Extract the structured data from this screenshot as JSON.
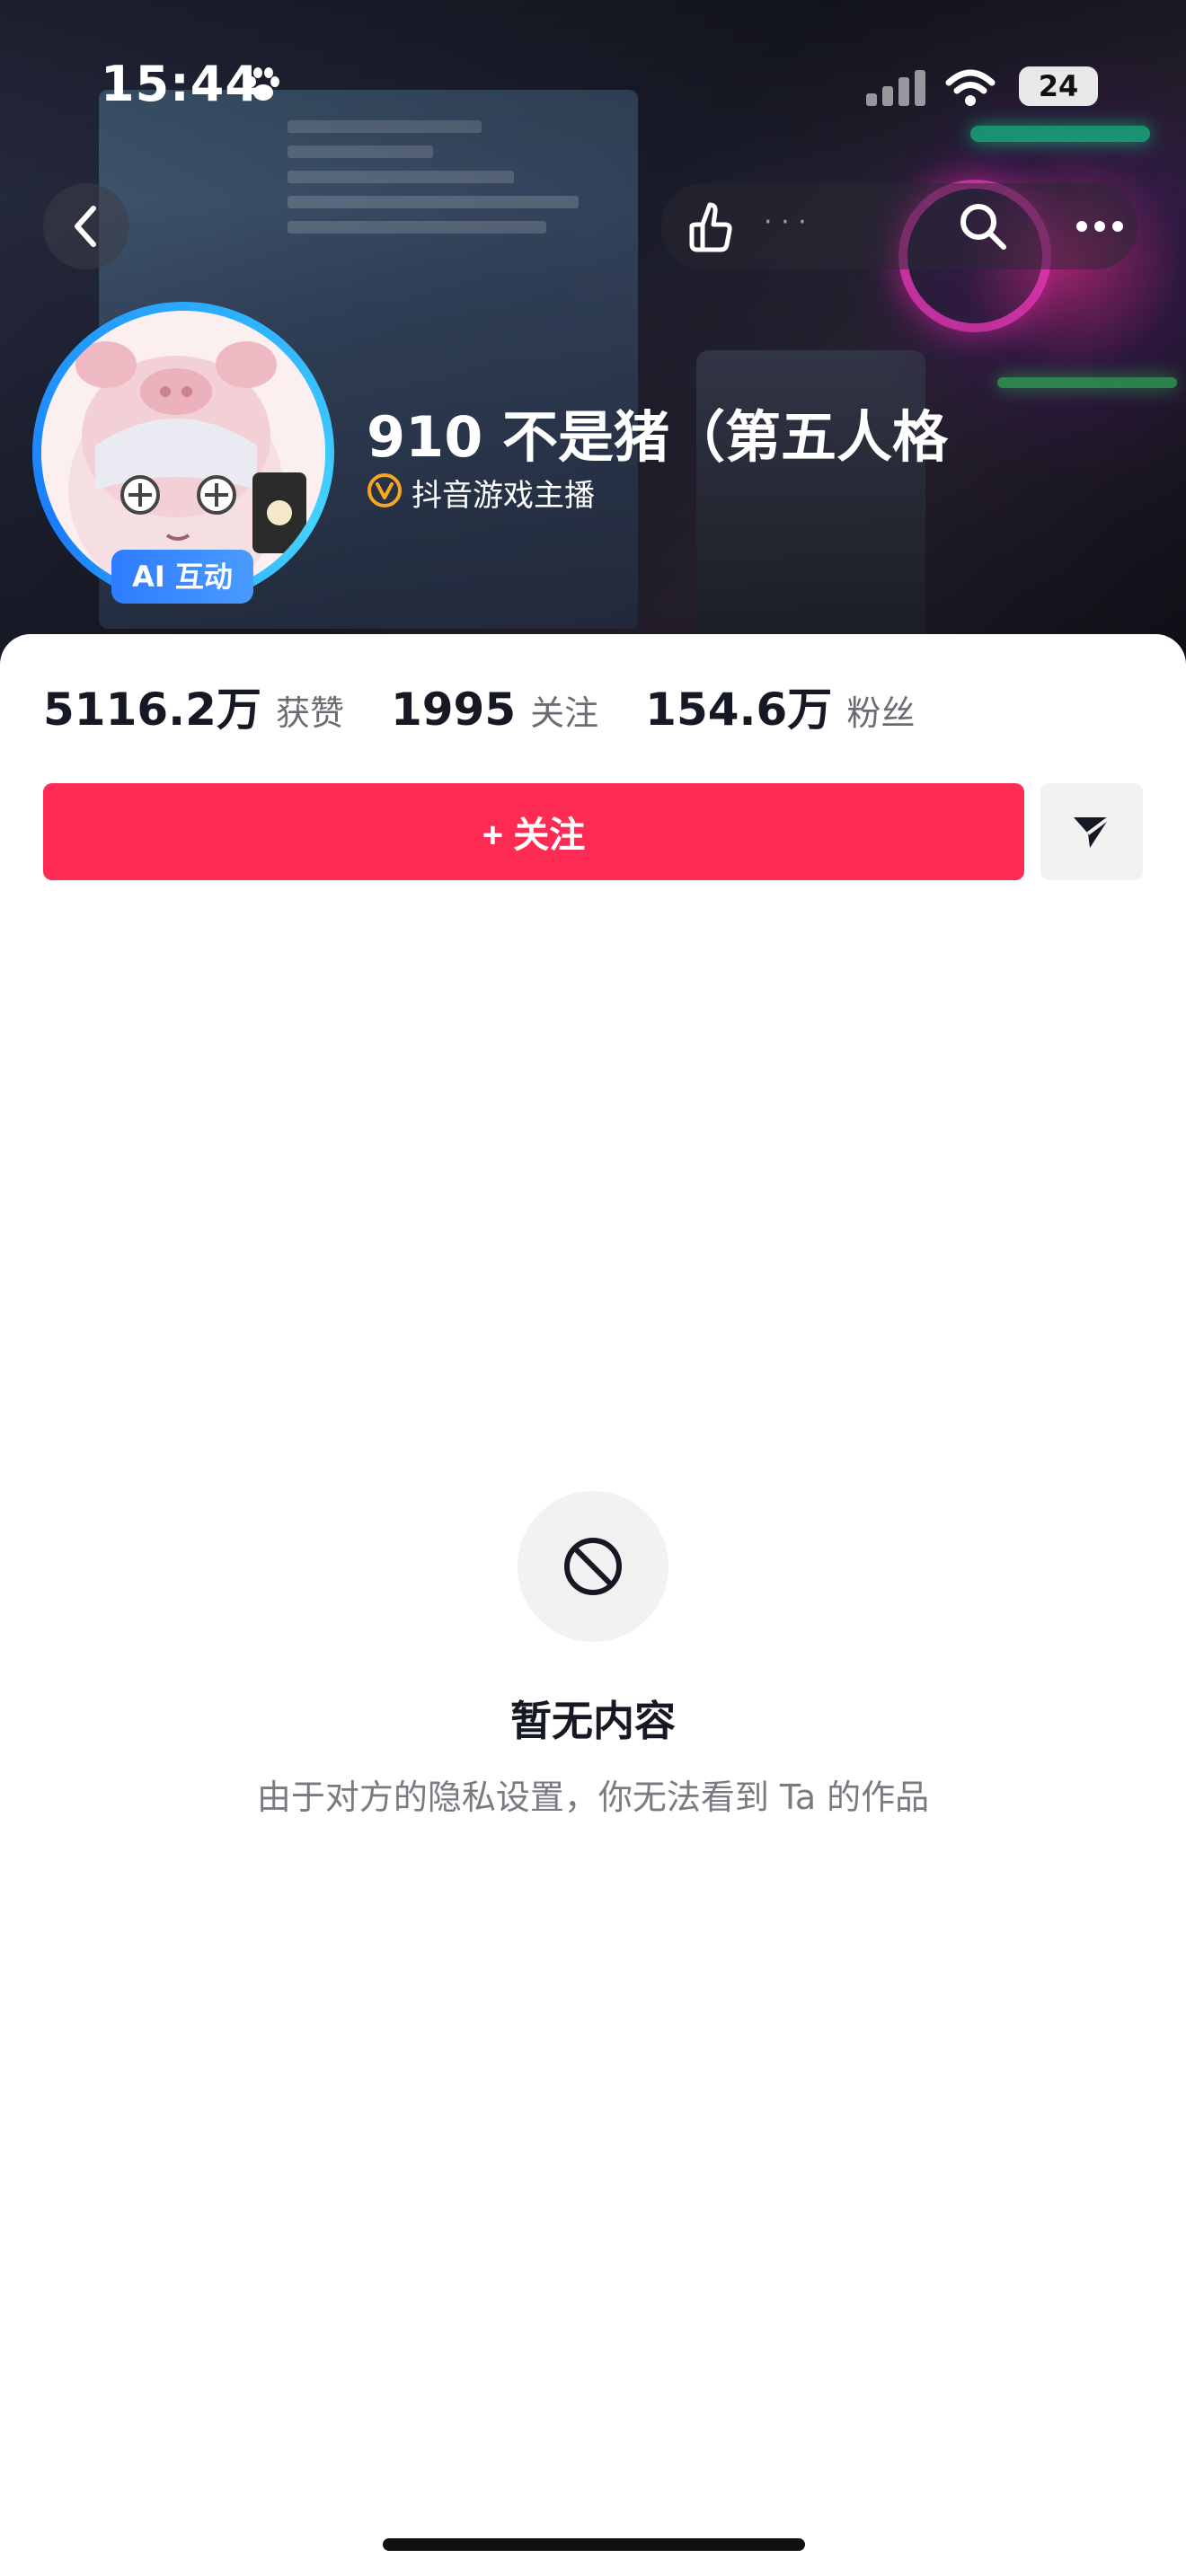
{
  "status_bar": {
    "time": "15:44",
    "battery": "24"
  },
  "nav": {
    "hint_text": "· · ·"
  },
  "profile": {
    "name": "910 不是猪（第五人格",
    "tag": "抖音游戏主播",
    "ai_badge": "AI 互动"
  },
  "stats": [
    {
      "value": "5116.2万",
      "label": "获赞"
    },
    {
      "value": "1995",
      "label": "关注"
    },
    {
      "value": "154.6万",
      "label": "粉丝"
    }
  ],
  "actions": {
    "follow_label": "+ 关注"
  },
  "empty_state": {
    "title": "暂无内容",
    "description": "由于对方的隐私设置，你无法看到 Ta 的作品"
  },
  "colors": {
    "accent": "#fe2c55",
    "avatar_ring": "#2aa9ff",
    "verify": "#f5a623"
  }
}
